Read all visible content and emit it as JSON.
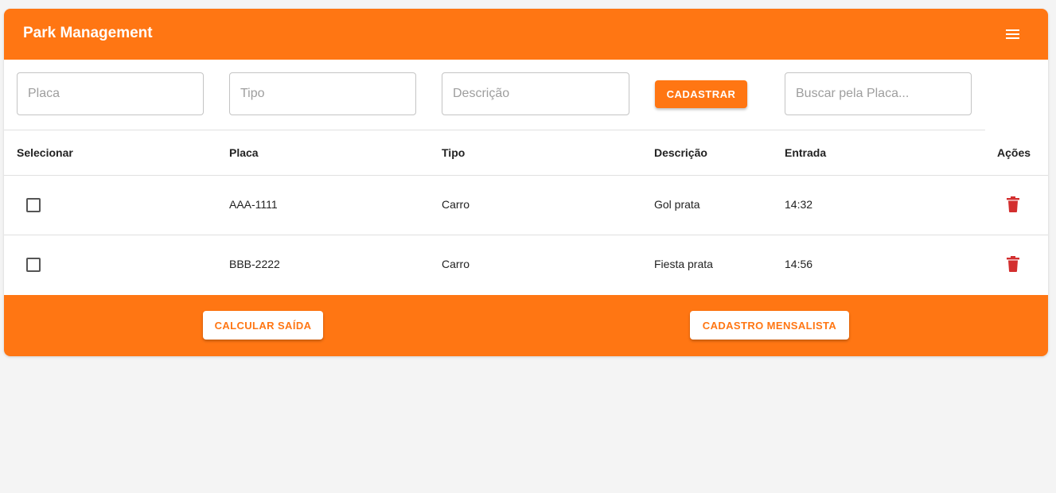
{
  "app": {
    "title": "Park Management",
    "accent_color": "#ff7613",
    "menu_icon": "menu-icon"
  },
  "form": {
    "placa_placeholder": "Placa",
    "tipo_placeholder": "Tipo",
    "descricao_placeholder": "Descrição",
    "submit_label": "CADASTRAR",
    "search_placeholder": "Buscar pela Placa..."
  },
  "table": {
    "headers": {
      "select": "Selecionar",
      "placa": "Placa",
      "tipo": "Tipo",
      "descricao": "Descrição",
      "entrada": "Entrada",
      "acoes": "Ações"
    },
    "rows": [
      {
        "placa": "AAA-1111",
        "tipo": "Carro",
        "descricao": "Gol prata",
        "entrada": "14:32",
        "action_icon": "trash-icon"
      },
      {
        "placa": "BBB-2222",
        "tipo": "Carro",
        "descricao": "Fiesta prata",
        "entrada": "14:56",
        "action_icon": "trash-icon"
      }
    ],
    "delete_color": "#d32f2f"
  },
  "footer": {
    "calcular_label": "CALCULAR SAÍDA",
    "mensalista_label": "CADASTRO MENSALISTA"
  }
}
